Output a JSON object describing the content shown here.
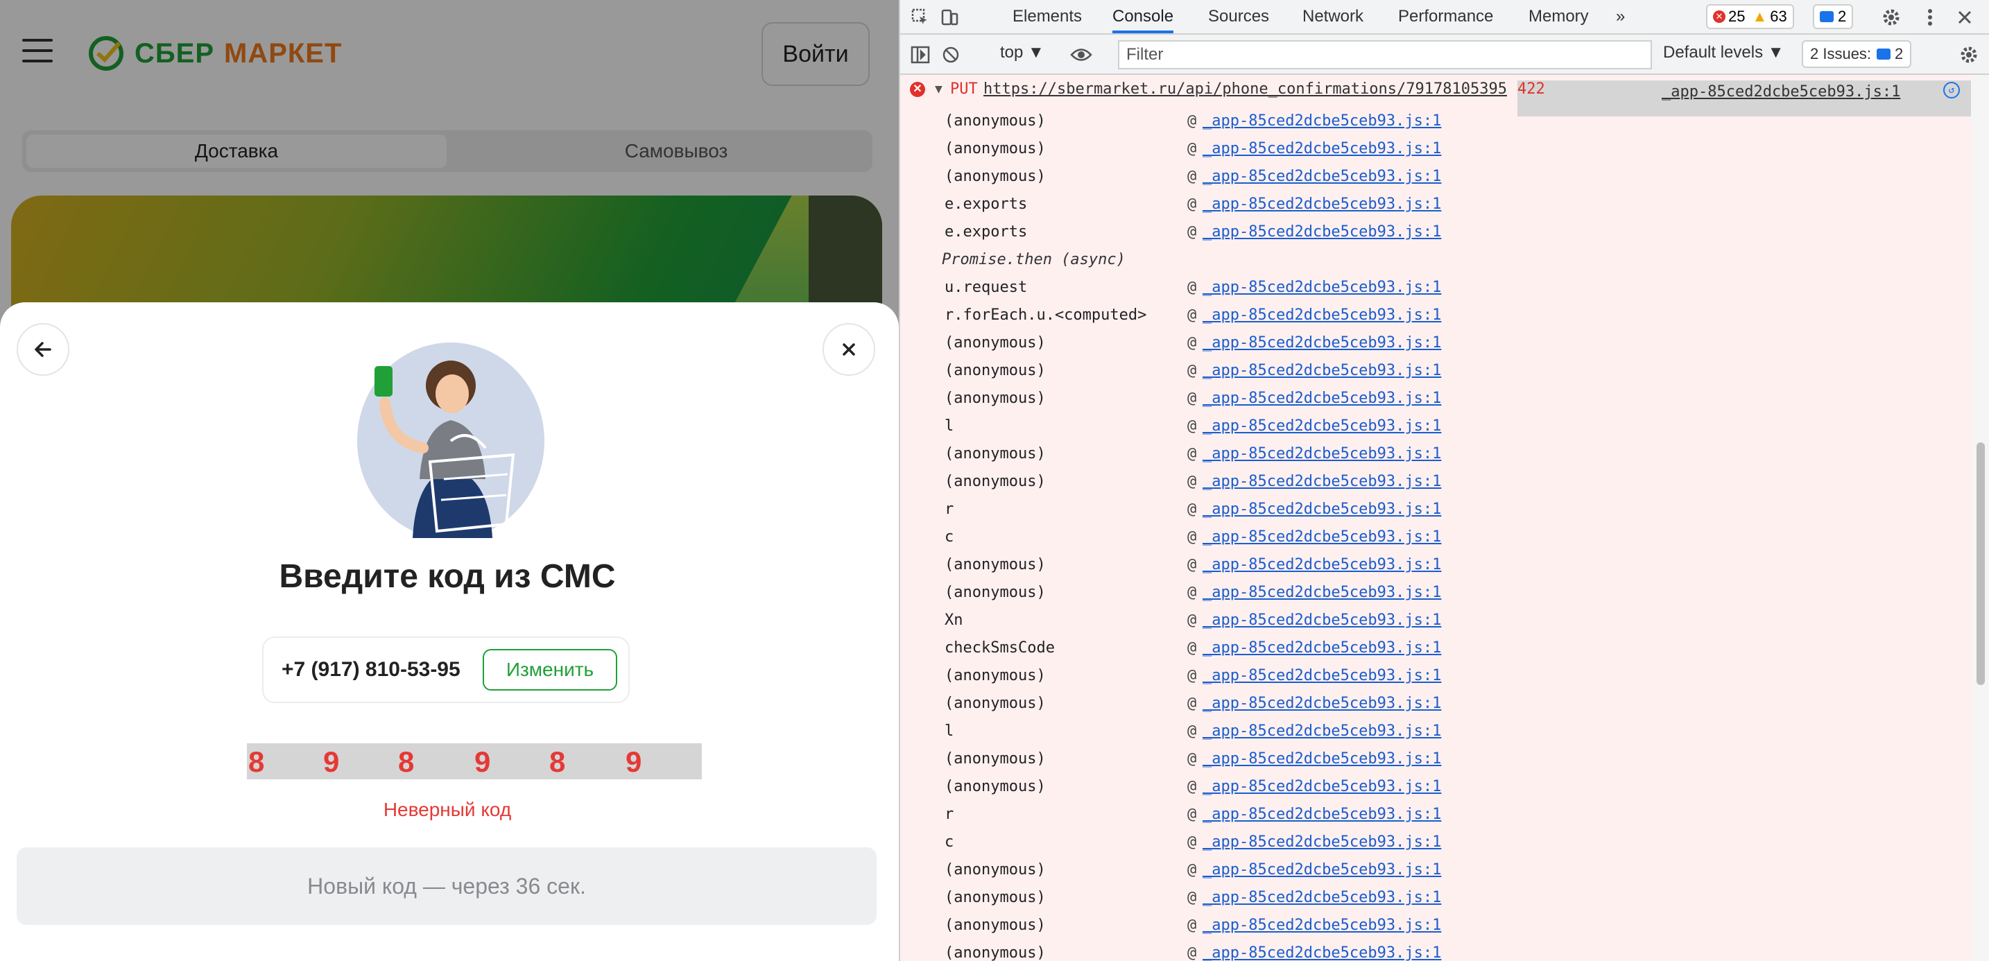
{
  "site": {
    "logo_part1": "СБЕР",
    "logo_part2": "МАРКЕТ",
    "login_label": "Войти",
    "tabs": [
      "Доставка",
      "Самовывоз"
    ],
    "modal": {
      "title": "Введите код из СМС",
      "phone": "+7 (917) 810-53-95",
      "change_label": "Изменить",
      "code_digits": [
        "8",
        "9",
        "8",
        "9",
        "8",
        "9"
      ],
      "error_text": "Неверный код",
      "resend_text": "Новый код — через 36 сек."
    }
  },
  "devtools": {
    "tabs": [
      "Elements",
      "Console",
      "Sources",
      "Network",
      "Performance",
      "Memory"
    ],
    "active_tab": "Console",
    "more_tabs": "»",
    "error_count": "25",
    "warning_count": "63",
    "message_count": "2",
    "context": "top",
    "filter_placeholder": "Filter",
    "levels": "Default levels",
    "issues": "2 Issues:",
    "issues_count": "2",
    "error": {
      "method": "PUT",
      "url": "https://sbermarket.ru/api/phone_confirmations/79178105395",
      "status": "422",
      "source": "_app-85ced2dcbe5ceb93.js:1"
    },
    "frames": [
      {
        "fn": "(anonymous)",
        "loc": "_app-85ced2dcbe5ceb93.js:1"
      },
      {
        "fn": "(anonymous)",
        "loc": "_app-85ced2dcbe5ceb93.js:1"
      },
      {
        "fn": "(anonymous)",
        "loc": "_app-85ced2dcbe5ceb93.js:1"
      },
      {
        "fn": "e.exports",
        "loc": "_app-85ced2dcbe5ceb93.js:1"
      },
      {
        "fn": "e.exports",
        "loc": "_app-85ced2dcbe5ceb93.js:1"
      },
      {
        "fn": "Promise.then (async)",
        "loc": "",
        "async": true
      },
      {
        "fn": "u.request",
        "loc": "_app-85ced2dcbe5ceb93.js:1"
      },
      {
        "fn": "r.forEach.u.<computed>",
        "loc": "_app-85ced2dcbe5ceb93.js:1"
      },
      {
        "fn": "(anonymous)",
        "loc": "_app-85ced2dcbe5ceb93.js:1"
      },
      {
        "fn": "(anonymous)",
        "loc": "_app-85ced2dcbe5ceb93.js:1"
      },
      {
        "fn": "(anonymous)",
        "loc": "_app-85ced2dcbe5ceb93.js:1"
      },
      {
        "fn": "l",
        "loc": "_app-85ced2dcbe5ceb93.js:1"
      },
      {
        "fn": "(anonymous)",
        "loc": "_app-85ced2dcbe5ceb93.js:1"
      },
      {
        "fn": "(anonymous)",
        "loc": "_app-85ced2dcbe5ceb93.js:1"
      },
      {
        "fn": "r",
        "loc": "_app-85ced2dcbe5ceb93.js:1"
      },
      {
        "fn": "c",
        "loc": "_app-85ced2dcbe5ceb93.js:1"
      },
      {
        "fn": "(anonymous)",
        "loc": "_app-85ced2dcbe5ceb93.js:1"
      },
      {
        "fn": "(anonymous)",
        "loc": "_app-85ced2dcbe5ceb93.js:1"
      },
      {
        "fn": "Xn",
        "loc": "_app-85ced2dcbe5ceb93.js:1"
      },
      {
        "fn": "checkSmsCode",
        "loc": "_app-85ced2dcbe5ceb93.js:1"
      },
      {
        "fn": "(anonymous)",
        "loc": "_app-85ced2dcbe5ceb93.js:1"
      },
      {
        "fn": "(anonymous)",
        "loc": "_app-85ced2dcbe5ceb93.js:1"
      },
      {
        "fn": "l",
        "loc": "_app-85ced2dcbe5ceb93.js:1"
      },
      {
        "fn": "(anonymous)",
        "loc": "_app-85ced2dcbe5ceb93.js:1"
      },
      {
        "fn": "(anonymous)",
        "loc": "_app-85ced2dcbe5ceb93.js:1"
      },
      {
        "fn": "r",
        "loc": "_app-85ced2dcbe5ceb93.js:1"
      },
      {
        "fn": "c",
        "loc": "_app-85ced2dcbe5ceb93.js:1"
      },
      {
        "fn": "(anonymous)",
        "loc": "_app-85ced2dcbe5ceb93.js:1"
      },
      {
        "fn": "(anonymous)",
        "loc": "_app-85ced2dcbe5ceb93.js:1"
      },
      {
        "fn": "(anonymous)",
        "loc": "_app-85ced2dcbe5ceb93.js:1"
      },
      {
        "fn": "(anonymous)",
        "loc": "_app-85ced2dcbe5ceb93.js:1"
      }
    ]
  },
  "colors": {
    "brand_green": "#21a038",
    "brand_orange": "#f07a1d",
    "error_red": "#e53935",
    "devtools_link": "#1a5dcc",
    "console_error_bg": "#fff0f0"
  }
}
